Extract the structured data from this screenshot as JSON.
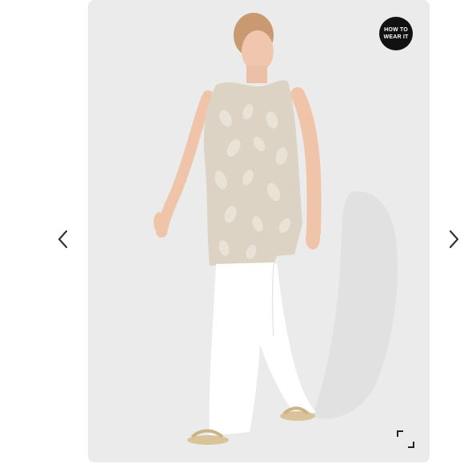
{
  "carousel": {
    "prev_icon": "chevron-left-icon",
    "next_icon": "chevron-right-icon",
    "expand_icon": "expand-icon"
  },
  "badge": {
    "line1": "HOW TO",
    "line2": "WEAR IT",
    "background": "#111111",
    "text_color": "#ffffff"
  },
  "colors": {
    "photo_background": "#ebebeb",
    "top_color": "#ddd3c4",
    "pants_color": "#ffffff",
    "chevron_color": "#333333"
  }
}
